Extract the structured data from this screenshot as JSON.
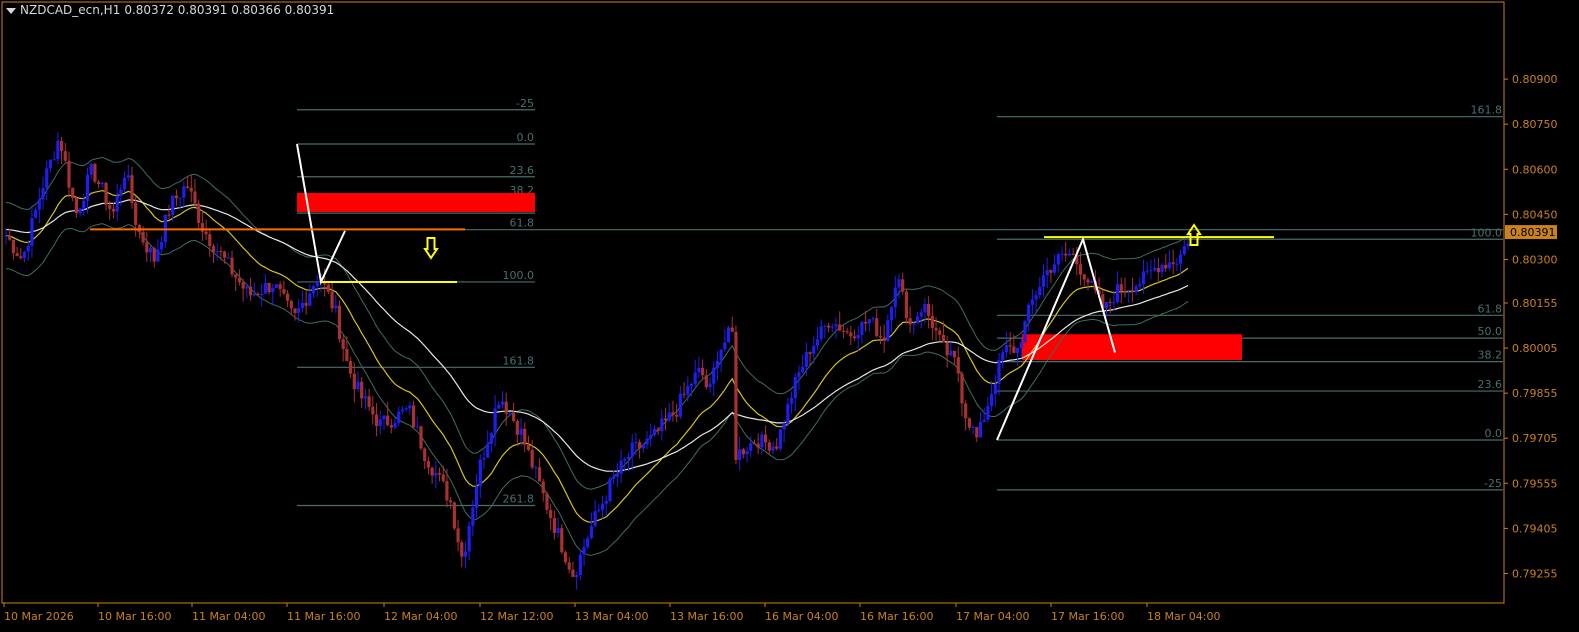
{
  "header": {
    "symbol": "NZDCAD_ecn,H1",
    "ohlc": "0.80372 0.80391 0.80366 0.80391"
  },
  "colors": {
    "background": "#000000",
    "frame": "#c8821e",
    "axis_text": "#c8821e",
    "bull": "#1e1ef0",
    "bear": "#a83232",
    "fib": "#4a6e6e",
    "fib_text": "#4a6e6e",
    "zone": "#ff0000",
    "ma_white": "#e6e6e6",
    "ma_yellow": "#d6c221",
    "ma_green": "#3e6e5e",
    "pattern_line": "#ffffff",
    "signal_arrow": "#ffff00",
    "orange_level": "#ff6a00",
    "price_label_bg": "#c8821e"
  },
  "price_axis": {
    "labels": [
      "0.80900",
      "0.80750",
      "0.80600",
      "0.80450",
      "0.80300",
      "0.80155",
      "0.80005",
      "0.79855",
      "0.79705",
      "0.79555",
      "0.79405",
      "0.79255"
    ],
    "current_price": "0.80391",
    "ymin": 0.7916,
    "ymax": 0.8113
  },
  "time_axis": {
    "labels": [
      "10 Mar 2026",
      "10 Mar 16:00",
      "11 Mar 04:00",
      "11 Mar 16:00",
      "12 Mar 04:00",
      "12 Mar 12:00",
      "13 Mar 04:00",
      "13 Mar 16:00",
      "16 Mar 04:00",
      "16 Mar 16:00",
      "17 Mar 04:00",
      "17 Mar 16:00",
      "18 Mar 04:00"
    ]
  },
  "fibo_left": {
    "levels": [
      {
        "label": "-25",
        "price": 0.80798
      },
      {
        "label": "0.0",
        "price": 0.80684
      },
      {
        "label": "23.6",
        "price": 0.80575
      },
      {
        "label": "38.2",
        "price": 0.80508
      },
      {
        "label": "50.0",
        "price": 0.80454
      },
      {
        "label": "61.8",
        "price": 0.80399
      },
      {
        "label": "100.0",
        "price": 0.80225
      },
      {
        "label": "161.8",
        "price": 0.79941
      },
      {
        "label": "261.8",
        "price": 0.79481
      }
    ]
  },
  "fibo_right": {
    "levels": [
      {
        "label": "161.8",
        "price": 0.80775
      },
      {
        "label": "100.0",
        "price": 0.80367
      },
      {
        "label": "61.8",
        "price": 0.80114
      },
      {
        "label": "50.0",
        "price": 0.80038
      },
      {
        "label": "38.2",
        "price": 0.7996
      },
      {
        "label": "23.6",
        "price": 0.79862
      },
      {
        "label": "0.0",
        "price": 0.79699
      },
      {
        "label": "-25",
        "price": 0.79533
      }
    ]
  },
  "zones": [
    {
      "name": "left-supply-zone",
      "top": 0.80521,
      "bottom": 0.80458
    },
    {
      "name": "right-demand-zone",
      "top": 0.80051,
      "bottom": 0.79965
    }
  ],
  "candles_summary": "H1 candlestick series from 10 Mar 2026 to 18 Mar 2026"
}
